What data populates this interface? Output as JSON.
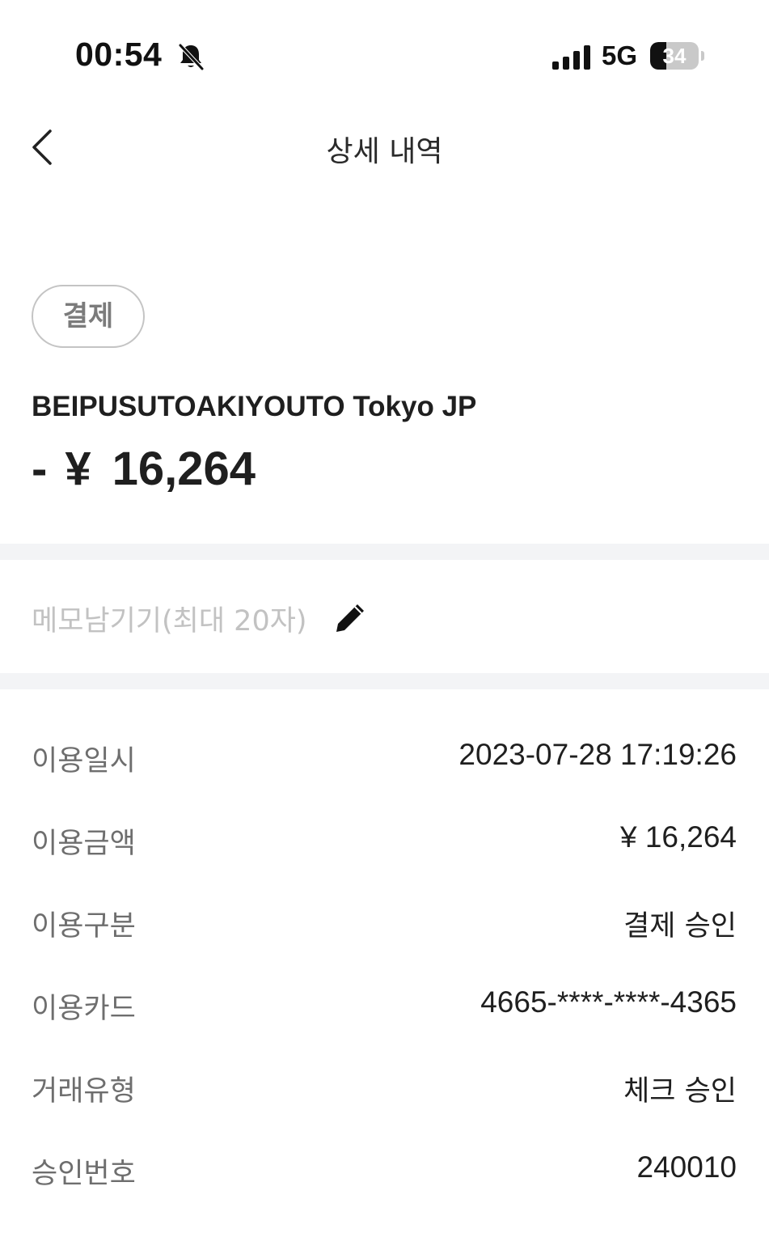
{
  "status_bar": {
    "time": "00:54",
    "network": "5G",
    "battery_percent": "34",
    "battery_level": 0.34,
    "icons": [
      "bell-slash-icon",
      "signal-icon",
      "battery-icon"
    ]
  },
  "header": {
    "title": "상세 내역",
    "back_icon": "chevron-left-icon"
  },
  "transaction": {
    "type_chip": "결제",
    "merchant": "BEIPUSUTOAKIYOUTO Tokyo JP",
    "amount_sign": "-",
    "amount_currency": "¥",
    "amount_value": "16,264"
  },
  "memo": {
    "placeholder": "메모남기기(최대 20자)",
    "icon": "pencil-icon"
  },
  "details": [
    {
      "label": "이용일시",
      "value": "2023-07-28 17:19:26"
    },
    {
      "label": "이용금액",
      "value": "¥  16,264"
    },
    {
      "label": "이용구분",
      "value": "결제 승인"
    },
    {
      "label": "이용카드",
      "value": "4665-****-****-4365"
    },
    {
      "label": "거래유형",
      "value": "체크 승인"
    },
    {
      "label": "승인번호",
      "value": "240010"
    }
  ],
  "colors": {
    "text_primary": "#1f1f1f",
    "text_label": "#6e6e6e",
    "placeholder": "#c2c2c2",
    "divider": "#f3f4f6",
    "chip_border": "#c4c4c4"
  }
}
